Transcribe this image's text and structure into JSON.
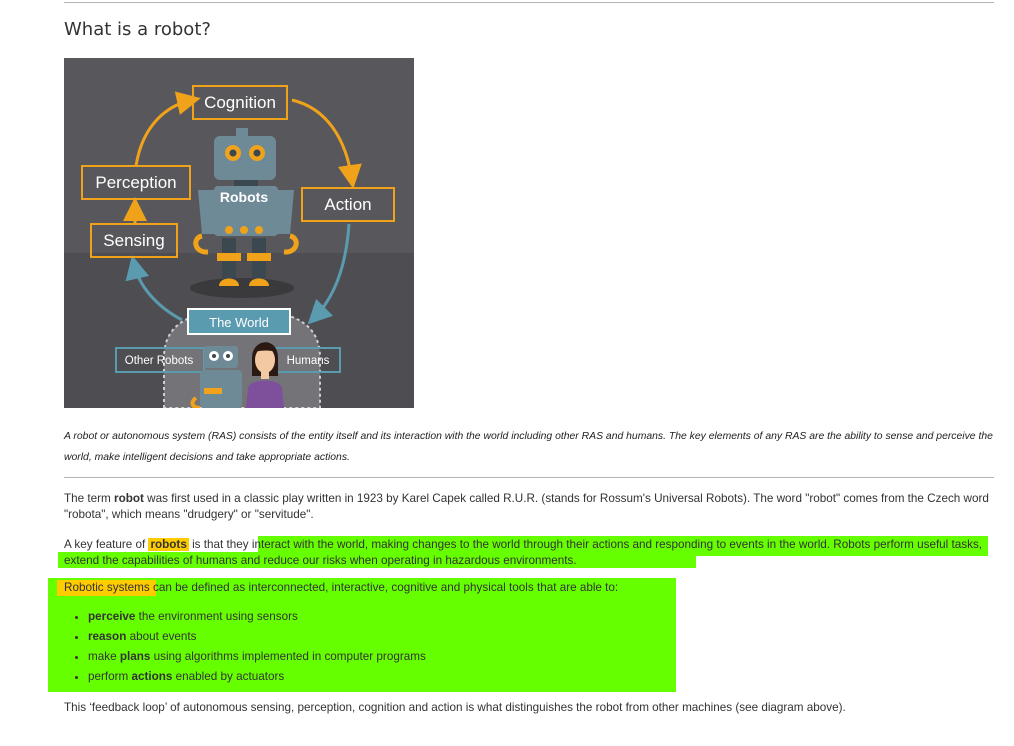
{
  "heading": "What is a robot?",
  "figure": {
    "labels": {
      "cognition": "Cognition",
      "perception": "Perception",
      "sensing": "Sensing",
      "action": "Action",
      "robots": "Robots",
      "world": "The World",
      "other_robots": "Other Robots",
      "humans": "Humans"
    },
    "colors": {
      "background": "#5a5a5e",
      "orange": "#f0a21b",
      "teal": "#5b9bb0",
      "robot_body": "#6f8a97"
    }
  },
  "caption": "A robot or autonomous system (RAS) consists of the entity itself and its interaction with the world including other RAS and humans. The key elements of any RAS are the ability to sense and perceive the world, make intelligent decisions and take appropriate actions.",
  "para1": {
    "a": "The term ",
    "b": "robot",
    "c": " was first used in a classic play written in 1923 by Karel Capek called R.U.R. (stands for Rossum's Universal Robots). The word \"robot\" comes from the Czech word \"robota\", which means \"drudgery\" or \"servitude\"."
  },
  "para2": {
    "a": "A key feature of ",
    "b": "robots",
    "c": " is that they ",
    "d": "interact with the world, making changes to the world through their actions and responding to events in the world. Robots perform useful tasks, extend the capabilities of humans and reduce our risks when operating in hazardous environments."
  },
  "para3": {
    "a": "Robotic systems",
    "b": " can be defined as interconnected, interactive, cognitive and physical tools that are able to:"
  },
  "bullets": [
    {
      "strong": "perceive",
      "rest": " the environment using sensors",
      "pre": ""
    },
    {
      "strong": "reason",
      "rest": " about events",
      "pre": ""
    },
    {
      "pre": "make ",
      "strong": "plans",
      "rest": " using algorithms implemented in computer programs"
    },
    {
      "pre": "perform ",
      "strong": "actions",
      "rest": " enabled by actuators"
    }
  ],
  "para_last": "This ‘feedback loop’ of autonomous sensing, perception, cognition and action is what distinguishes the robot from other machines (see diagram above).",
  "colors": {
    "highlight_yellow": "#ffcc00",
    "highlight_green": "#66ff00"
  }
}
